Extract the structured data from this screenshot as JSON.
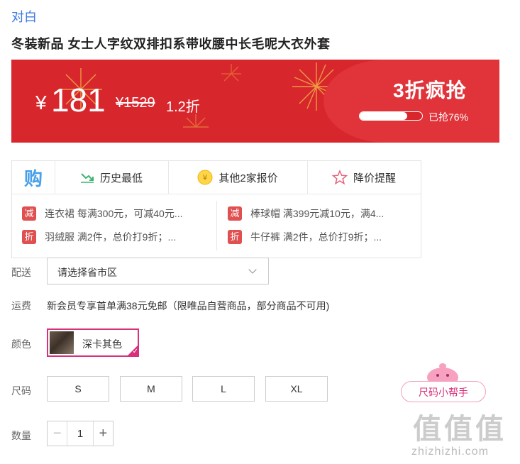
{
  "brand": "对白",
  "product_title": "冬装新品 女士人字纹双排扣系带收腰中长毛呢大衣外套",
  "banner": {
    "currency": "¥",
    "price": "181",
    "original_price": "¥1529",
    "discount": "1.2折",
    "sale_title": "3折疯抢",
    "sold_text": "已抢76%",
    "sold_progress": 0.76
  },
  "compare": {
    "logo_text": "购",
    "items": [
      {
        "label": "历史最低",
        "icon": "trend-down-icon"
      },
      {
        "label": "其他2家报价",
        "icon": "yuan-coin-icon"
      },
      {
        "label": "降价提醒",
        "icon": "star-icon"
      }
    ],
    "promos": [
      {
        "tag": "减",
        "text": "连衣裙 每满300元，可减40元..."
      },
      {
        "tag": "减",
        "text": "棒球帽 满399元减10元，满4..."
      },
      {
        "tag": "折",
        "text": "羽绒服 满2件，总价打9折；..."
      },
      {
        "tag": "折",
        "text": "牛仔裤 满2件，总价打9折；..."
      }
    ]
  },
  "delivery": {
    "label": "配送",
    "placeholder": "请选择省市区"
  },
  "shipping": {
    "label": "运费",
    "text": "新会员专享首单满38元免邮（限唯品自营商品，部分商品不可用)"
  },
  "color": {
    "label": "颜色",
    "selected": "深卡其色"
  },
  "size": {
    "label": "尺码",
    "options": [
      "S",
      "M",
      "L",
      "XL"
    ]
  },
  "quantity": {
    "label": "数量",
    "minus": "−",
    "value": "1",
    "plus": "+"
  },
  "helper": {
    "label": "尺码小帮手"
  },
  "watermark": {
    "big": "值值值",
    "small": "zhizhizhi.com"
  }
}
